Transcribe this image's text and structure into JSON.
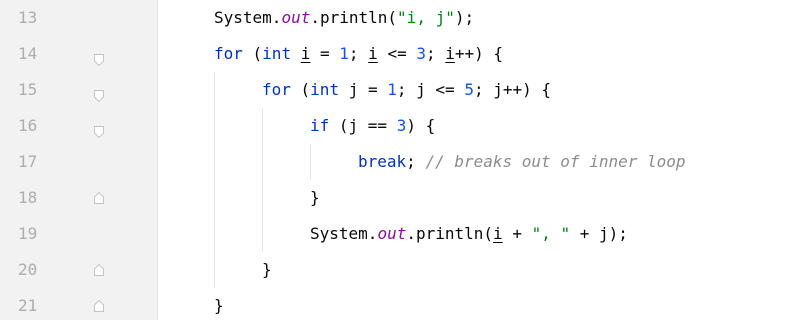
{
  "line_numbers": [
    "13",
    "14",
    "15",
    "16",
    "17",
    "18",
    "19",
    "20",
    "21"
  ],
  "code": {
    "l13": {
      "a": "System.",
      "fld": "out",
      "b": ".println(",
      "str": "\"i, j\"",
      "c": ");"
    },
    "l14": {
      "kw1": "for",
      "a": " (",
      "kw2": "int",
      "b": " ",
      "v1": "i",
      "c": " = ",
      "n1": "1",
      "d": "; ",
      "v2": "i",
      "e": " <= ",
      "n2": "3",
      "f": "; ",
      "v3": "i",
      "g": "++) {"
    },
    "l15": {
      "kw1": "for",
      "a": " (",
      "kw2": "int",
      "b": " j = ",
      "n1": "1",
      "c": "; j <= ",
      "n2": "5",
      "d": "; j++) {"
    },
    "l16": {
      "kw": "if",
      "a": " (j == ",
      "n": "3",
      "b": ") {"
    },
    "l17": {
      "kw": "break",
      "a": "; ",
      "cmt": "// breaks out of inner loop"
    },
    "l18": {
      "a": "}"
    },
    "l19": {
      "a": "System.",
      "fld": "out",
      "b": ".println(",
      "v": "i",
      "c": " + ",
      "str": "\", \"",
      "d": " + j);"
    },
    "l20": {
      "a": "}"
    },
    "l21": {
      "a": "}"
    }
  },
  "colors": {
    "keyword": "#0033b3",
    "number": "#1750eb",
    "string": "#067d17",
    "field": "#871094",
    "comment": "#8c8c8c",
    "text": "#080808",
    "gutter_bg": "#f2f2f2",
    "line_number": "#adadad"
  },
  "icons": {
    "fold_open": "fold-open-icon",
    "fold_close": "fold-close-icon"
  }
}
